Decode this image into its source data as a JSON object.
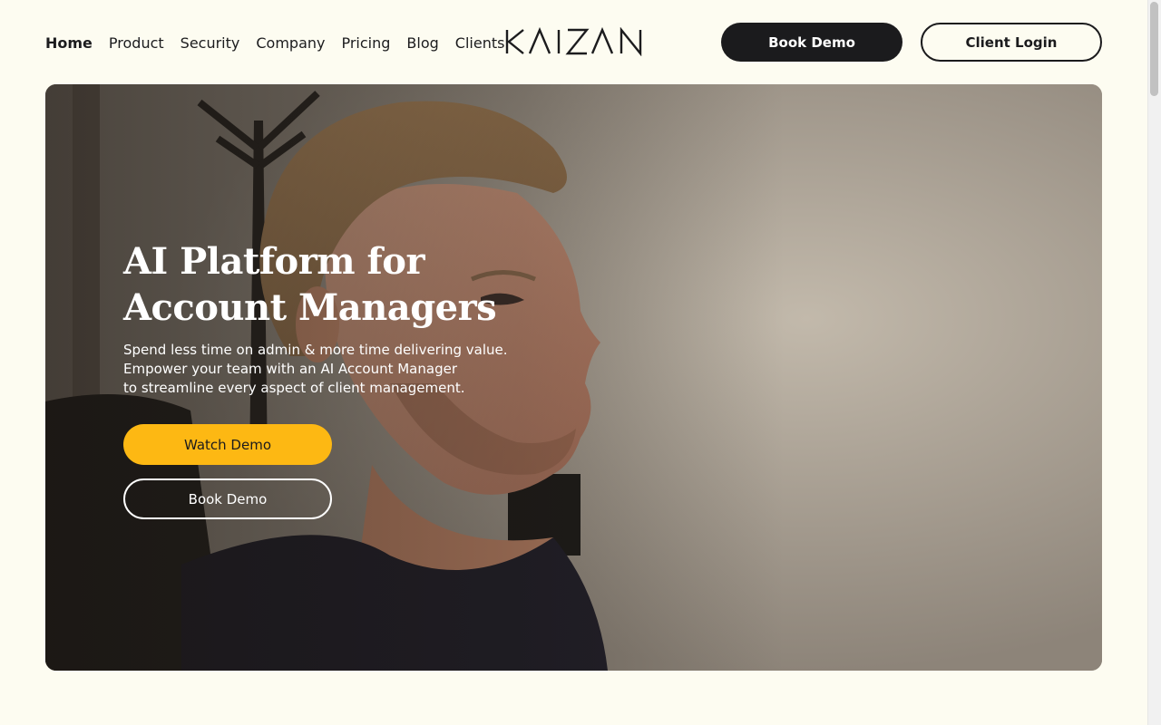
{
  "nav": {
    "items": [
      {
        "label": "Home",
        "active": true
      },
      {
        "label": "Product",
        "active": false
      },
      {
        "label": "Security",
        "active": false
      },
      {
        "label": "Company",
        "active": false
      },
      {
        "label": "Pricing",
        "active": false
      },
      {
        "label": "Blog",
        "active": false
      },
      {
        "label": "Clients",
        "active": false
      }
    ]
  },
  "logo": {
    "text": "KAIZAN"
  },
  "header": {
    "book_demo_label": "Book Demo",
    "client_login_label": "Client Login"
  },
  "hero": {
    "title_line1": "AI Platform for",
    "title_line2": "Account Managers",
    "subtitle_line1": "Spend less time on admin & more time delivering value.",
    "subtitle_line2": "Empower your team with an AI Account Manager",
    "subtitle_line3": "to streamline every aspect of client management.",
    "watch_demo_label": "Watch Demo",
    "book_demo_label": "Book Demo",
    "image": "man-at-desk-photo"
  },
  "colors": {
    "page_bg": "#fdfcf1",
    "dark_button": "#1b1b1d",
    "accent_yellow": "#fdb813"
  }
}
